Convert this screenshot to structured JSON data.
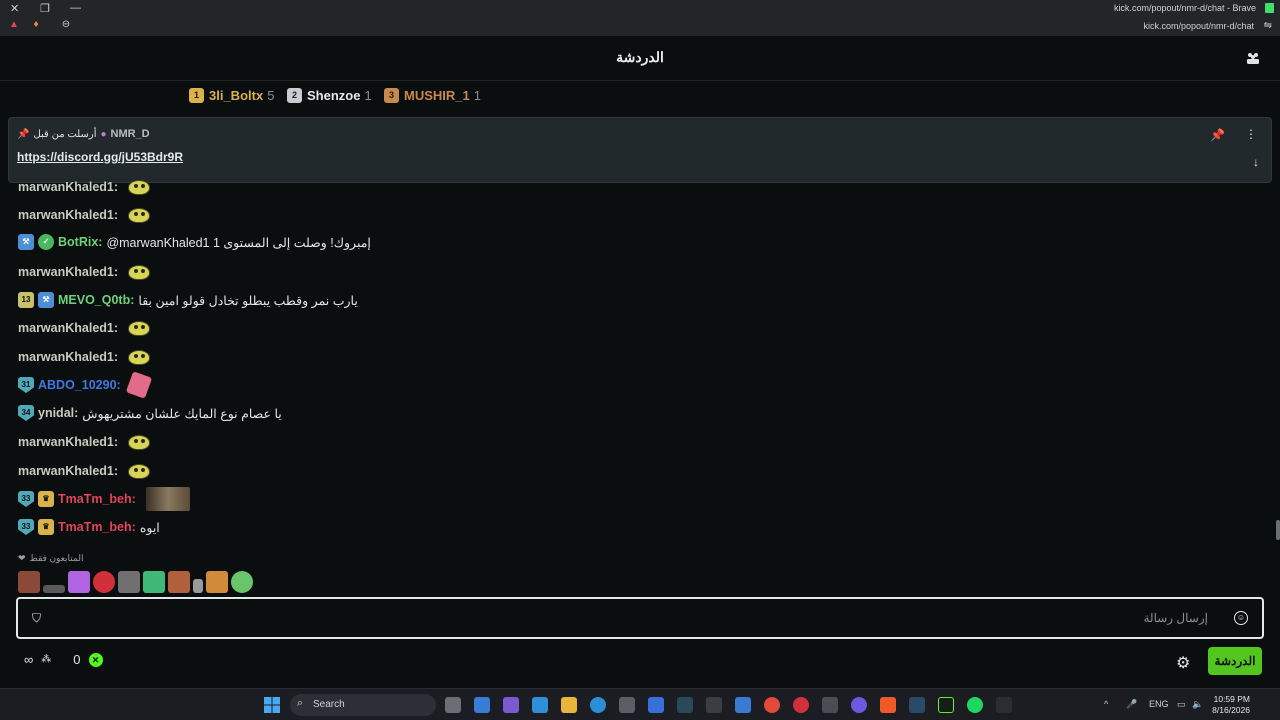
{
  "browser": {
    "window_title": "kick.com/popout/nmr-d/chat - Brave",
    "url": "kick.com/popout/nmr-d/chat"
  },
  "chat": {
    "title": "الدردشة",
    "leaderboard": [
      {
        "rank": "1",
        "name": "3li_Boltx",
        "count": "5",
        "color": "#d9b24a"
      },
      {
        "rank": "2",
        "name": "Shenzoe",
        "count": "1",
        "color": "#c9ccd0"
      },
      {
        "rank": "3",
        "name": "MUSHIR_1",
        "count": "1",
        "color": "#c78a4a"
      }
    ],
    "pinned": {
      "label": "أرسلت من قبل",
      "user": "NMR_D",
      "link": "https://discord.gg/jU53Bdr9R"
    },
    "messages": [
      {
        "user": "marwanKhaled1",
        "text": ""
      },
      {
        "user": "marwanKhaled1",
        "text": ""
      },
      {
        "user": "BotRix",
        "text": "@marwanKhaled1 إمبروك! وصلت إلى المستوى 1"
      },
      {
        "user": "marwanKhaled1",
        "text": ""
      },
      {
        "user": "MEVO_Q0tb",
        "badge": "13",
        "text": "يارب نمر وقطب يبطلو تخادل قولو امين بقا"
      },
      {
        "user": "marwanKhaled1",
        "text": ""
      },
      {
        "user": "marwanKhaled1",
        "text": ""
      },
      {
        "user": "ABDO_10290",
        "badge": "31",
        "text": ""
      },
      {
        "user": "ynidal",
        "badge": "34",
        "text": "يا عصام نوع المايك علشان مشتريهوش"
      },
      {
        "user": "marwanKhaled1",
        "text": ""
      },
      {
        "user": "marwanKhaled1",
        "text": ""
      },
      {
        "user": "TmaTm_beh",
        "badge": "33",
        "text": ""
      },
      {
        "user": "TmaTm_beh",
        "badge": "33",
        "text": "ايوه"
      }
    ],
    "supporters_label": "المتابعون فقط",
    "input_placeholder": "إرسال رسالة",
    "points": "0",
    "send_label": "الدردشة"
  },
  "taskbar": {
    "search_label": "Search",
    "lang": "ENG",
    "time": "10:59 PM",
    "date": "8/16/2026"
  },
  "colors": {
    "kick_green": "#53fc18",
    "send_green": "#53c51f",
    "background": "#0b0e0f"
  }
}
